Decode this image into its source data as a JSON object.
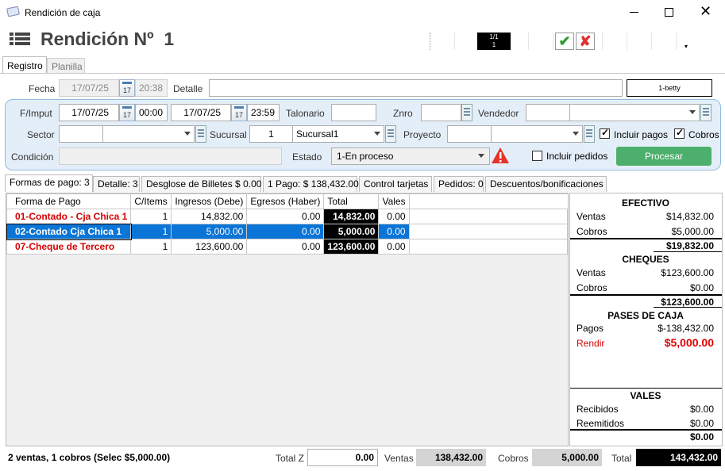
{
  "window": {
    "title": "Rendición de caja",
    "heading": "Rendición Nº  1"
  },
  "nav": {
    "counter_top": "1/1",
    "counter_bottom": "1"
  },
  "top_tabs": [
    "Registro",
    "Planilla"
  ],
  "registro": {
    "fecha_label": "Fecha",
    "fecha_value": "17/07/25",
    "fecha_time": "20:38",
    "cal_day": "17",
    "detalle_label": "Detalle",
    "detalle_value": "",
    "user_badge": "1-betty"
  },
  "filters": {
    "fimput_label": "F/Imput",
    "from_date": "17/07/25",
    "from_time": "00:00",
    "to_date": "17/07/25",
    "to_time": "23:59",
    "talonario_label": "Talonario",
    "talonario_value": "",
    "znro_label": "Znro",
    "znro_value": "",
    "vendedor_label": "Vendedor",
    "vendedor_code": "",
    "vendedor_name": "",
    "sector_label": "Sector",
    "sector_code": "",
    "sector_name": "",
    "sucursal_label": "Sucursal",
    "sucursal_code": "1",
    "sucursal_name": "Sucursal1",
    "proyecto_label": "Proyecto",
    "proyecto_code": "",
    "proyecto_name": "",
    "incluir_pagos_label": "Incluir pagos",
    "incluir_pagos": true,
    "cobros_label": "Cobros",
    "cobros": true,
    "condicion_label": "Condición",
    "condicion_value": "",
    "estado_label": "Estado",
    "estado_value": "1-En proceso",
    "incluir_pedidos_label": "Incluir pedidos",
    "incluir_pedidos": false,
    "procesar_label": "Procesar"
  },
  "tabs": [
    "Formas de pago: 3",
    "Detalle: 3",
    "Desglose de Billetes $ 0.00",
    "1 Pago: $ 138,432.00",
    "Control tarjetas",
    "Pedidos: 0",
    "Descuentos/bonificaciones"
  ],
  "table": {
    "columns": [
      "Forma de Pago",
      "C/Items",
      "Ingresos (Debe)",
      "Egresos (Haber)",
      "Total",
      "Vales"
    ],
    "rows": [
      {
        "forma": "01-Contado - Cja Chica 1",
        "items": "1",
        "ingresos": "14,832.00",
        "egresos": "0.00",
        "total": "14,832.00",
        "vales": "0.00"
      },
      {
        "forma": "02-Contado Cja Chica 1",
        "items": "1",
        "ingresos": "5,000.00",
        "egresos": "0.00",
        "total": "5,000.00",
        "vales": "0.00"
      },
      {
        "forma": "07-Cheque de Tercero",
        "items": "1",
        "ingresos": "123,600.00",
        "egresos": "0.00",
        "total": "123,600.00",
        "vales": "0.00"
      }
    ]
  },
  "summary": {
    "efectivo": {
      "title": "EFECTIVO",
      "ventas_label": "Ventas",
      "ventas": "$14,832.00",
      "cobros_label": "Cobros",
      "cobros": "$5,000.00",
      "total": "$19,832.00"
    },
    "cheques": {
      "title": "CHEQUES",
      "ventas_label": "Ventas",
      "ventas": "$123,600.00",
      "cobros_label": "Cobros",
      "cobros": "$0.00",
      "total": "$123,600.00"
    },
    "pases": {
      "title": "PASES DE CAJA",
      "pagos_label": "Pagos",
      "pagos": "$-138,432.00",
      "rendir_label": "Rendir",
      "rendir": "$5,000.00"
    },
    "vales": {
      "title": "VALES",
      "recibidos_label": "Recibidos",
      "recibidos": "$0.00",
      "reemitidos_label": "Reemitidos",
      "reemitidos": "$0.00",
      "total": "$0.00"
    }
  },
  "footer": {
    "status": "2 ventas, 1 cobros (Selec $5,000.00)",
    "totalz_label": "Total Z",
    "totalz": "0.00",
    "ventas_label": "Ventas",
    "ventas": "138,432.00",
    "cobros_label": "Cobros",
    "cobros": "5,000.00",
    "total_label": "Total",
    "total": "143,432.00"
  },
  "colors": {
    "accent_green": "#4caf6b",
    "selection_blue": "#0a75d6",
    "warning": "#e8332a",
    "filter_bg": "#e4eef8"
  }
}
